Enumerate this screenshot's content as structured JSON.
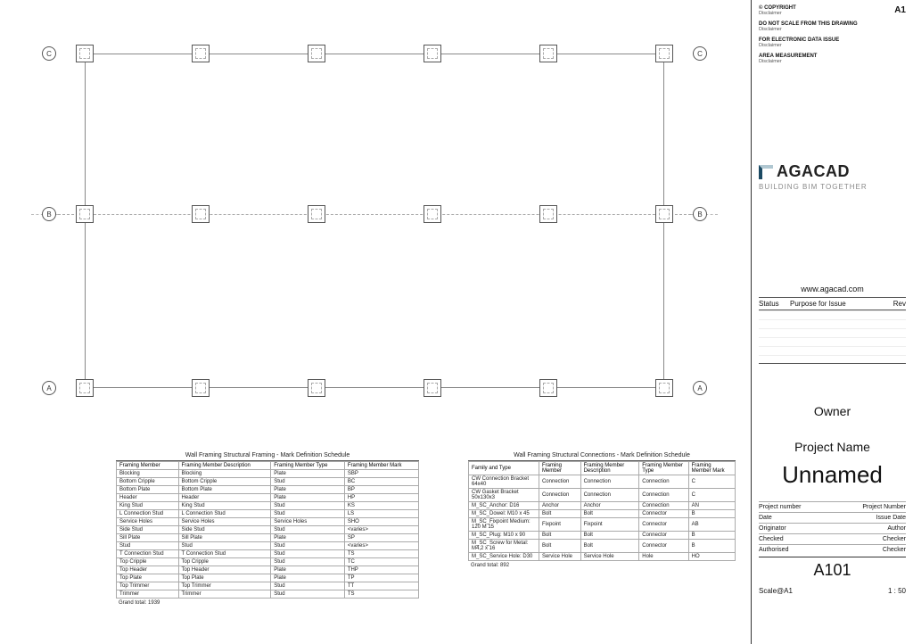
{
  "sheet_number_top": "A1",
  "notes": [
    {
      "t": "© COPYRIGHT",
      "s": "Disclaimer"
    },
    {
      "t": "DO NOT SCALE FROM THIS DRAWING",
      "s": "Disclaimer"
    },
    {
      "t": "FOR ELECTRONIC DATA ISSUE",
      "s": "Disclaimer"
    },
    {
      "t": "AREA MEASUREMENT",
      "s": "Disclaimer"
    }
  ],
  "logo_text": "AGACAD",
  "logo_sub": "BUILDING BIM TOGETHER",
  "url": "www.agacad.com",
  "rev_headers": {
    "status": "Status",
    "purpose": "Purpose for Issue",
    "rev": "Rev"
  },
  "owner": "Owner",
  "project": "Project Name",
  "big": "Unnamed",
  "meta": [
    {
      "k": "Project number",
      "v": "Project Number"
    },
    {
      "k": "Date",
      "v": "Issue Date"
    },
    {
      "k": "Originator",
      "v": "Author"
    },
    {
      "k": "Checked",
      "v": "Checker"
    },
    {
      "k": "Authorised",
      "v": "Checker"
    }
  ],
  "sheetcode": "A101",
  "scale_label": "Scale@A1",
  "scale_val": "1 : 50",
  "grid_rows": [
    {
      "label": "C",
      "pct": 0
    },
    {
      "label": "B",
      "pct": 48
    },
    {
      "label": "A",
      "pct": 100
    }
  ],
  "grid_cols_pct": [
    0,
    20,
    40,
    60,
    80,
    100
  ],
  "schedule1": {
    "title": "Wall Framing Structural Framing - Mark Definition Schedule",
    "headers": [
      "Framing Member",
      "Framing Member Description",
      "Framing Member Type",
      "Framing Member Mark"
    ],
    "rows": [
      [
        "Blocking",
        "Blocking",
        "Plate",
        "SBP"
      ],
      [
        "Bottom Cripple",
        "Bottom Cripple",
        "Stud",
        "BC"
      ],
      [
        "Bottom Plate",
        "Bottom Plate",
        "Plate",
        "BP"
      ],
      [
        "Header",
        "Header",
        "Plate",
        "HP"
      ],
      [
        "King Stud",
        "King Stud",
        "Stud",
        "KS"
      ],
      [
        "L Connection Stud",
        "L Connection Stud",
        "Stud",
        "LS"
      ],
      [
        "Service Holes",
        "Service Holes",
        "Service Holes",
        "SHO"
      ],
      [
        "Side Stud",
        "Side Stud",
        "Stud",
        "<varies>"
      ],
      [
        "Sill Plate",
        "Sill Plate",
        "Plate",
        "SP"
      ],
      [
        "Stud",
        "Stud",
        "Stud",
        "<varies>"
      ],
      [
        "T Connection Stud",
        "T Connection Stud",
        "Stud",
        "TS"
      ],
      [
        "Top Cripple",
        "Top Cripple",
        "Stud",
        "TC"
      ],
      [
        "Top Header",
        "Top Header",
        "Plate",
        "THP"
      ],
      [
        "Top Plate",
        "Top Plate",
        "Plate",
        "TP"
      ],
      [
        "Top Trimmer",
        "Top Trimmer",
        "Stud",
        "TT"
      ],
      [
        "Trimmer",
        "Trimmer",
        "Stud",
        "TS"
      ]
    ],
    "footer": "Grand total: 1939"
  },
  "schedule2": {
    "title": "Wall Framing Structural Connections - Mark Definition Schedule",
    "headers": [
      "Family and Type",
      "Framing Member",
      "Framing Member Description",
      "Framing Member Type",
      "Framing Member Mark"
    ],
    "rows": [
      [
        "CW Connection Bracket 64x40",
        "Connection",
        "Connection",
        "Connection",
        "C"
      ],
      [
        "CW Gasket Bracket 50x130x3",
        "Connection",
        "Connection",
        "Connection",
        "C"
      ],
      [
        "M_SC_Anchor: D16",
        "Anchor",
        "Anchor",
        "Connection",
        "AN"
      ],
      [
        "M_SC_Dowel: M10 x 45",
        "Bolt",
        "Bolt",
        "Connector",
        "B"
      ],
      [
        "M_SC_Fixpoint Medium: 120 M 15",
        "Fixpoint",
        "Fixpoint",
        "Connector",
        "AB"
      ],
      [
        "M_SC_Plug: M10 x 90",
        "Bolt",
        "Bolt",
        "Connector",
        "B"
      ],
      [
        "M_SC_Screw for Metal: M4,2 x 16",
        "Bolt",
        "Bolt",
        "Connector",
        "B"
      ],
      [
        "M_SC_Service Hole: D30",
        "Service Hole",
        "Service Hole",
        "Hole",
        "HO"
      ]
    ],
    "footer": "Grand total: 892"
  }
}
